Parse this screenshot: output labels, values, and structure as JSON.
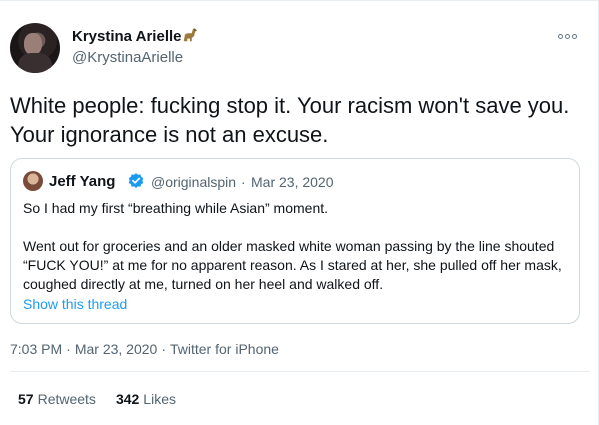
{
  "author": {
    "name": "Krystina Arielle",
    "handle": "@KrystinaArielle"
  },
  "tweet": {
    "text": "White people: fucking stop it. Your racism won't save you. Your ignorance is not an excuse."
  },
  "quoted": {
    "name": "Jeff Yang",
    "handle": "@originalspin",
    "separator": "·",
    "date": "Mar 23, 2020",
    "paragraph1": "So I had my first “breathing while Asian” moment.",
    "paragraph2": "Went out for groceries and an older masked white woman passing by the line shouted “FUCK YOU!” at me for no apparent reason. As I stared at her, she pulled off her mask, coughed directly at me, turned on her heel and walked off.",
    "show_thread": "Show this thread"
  },
  "meta": {
    "time": "7:03 PM",
    "sep1": "·",
    "date": "Mar 23, 2020",
    "sep2": "·",
    "source": "Twitter for iPhone"
  },
  "stats": {
    "retweets_count": "57",
    "retweets_label": "Retweets",
    "likes_count": "342",
    "likes_label": "Likes"
  },
  "colors": {
    "link": "#1d9bf0",
    "secondary_text": "#536471",
    "border": "#cfd9de"
  },
  "icons": {
    "name_emoji": "dinosaur-icon",
    "verified": "verified-badge-icon",
    "more": "more-options-icon"
  }
}
